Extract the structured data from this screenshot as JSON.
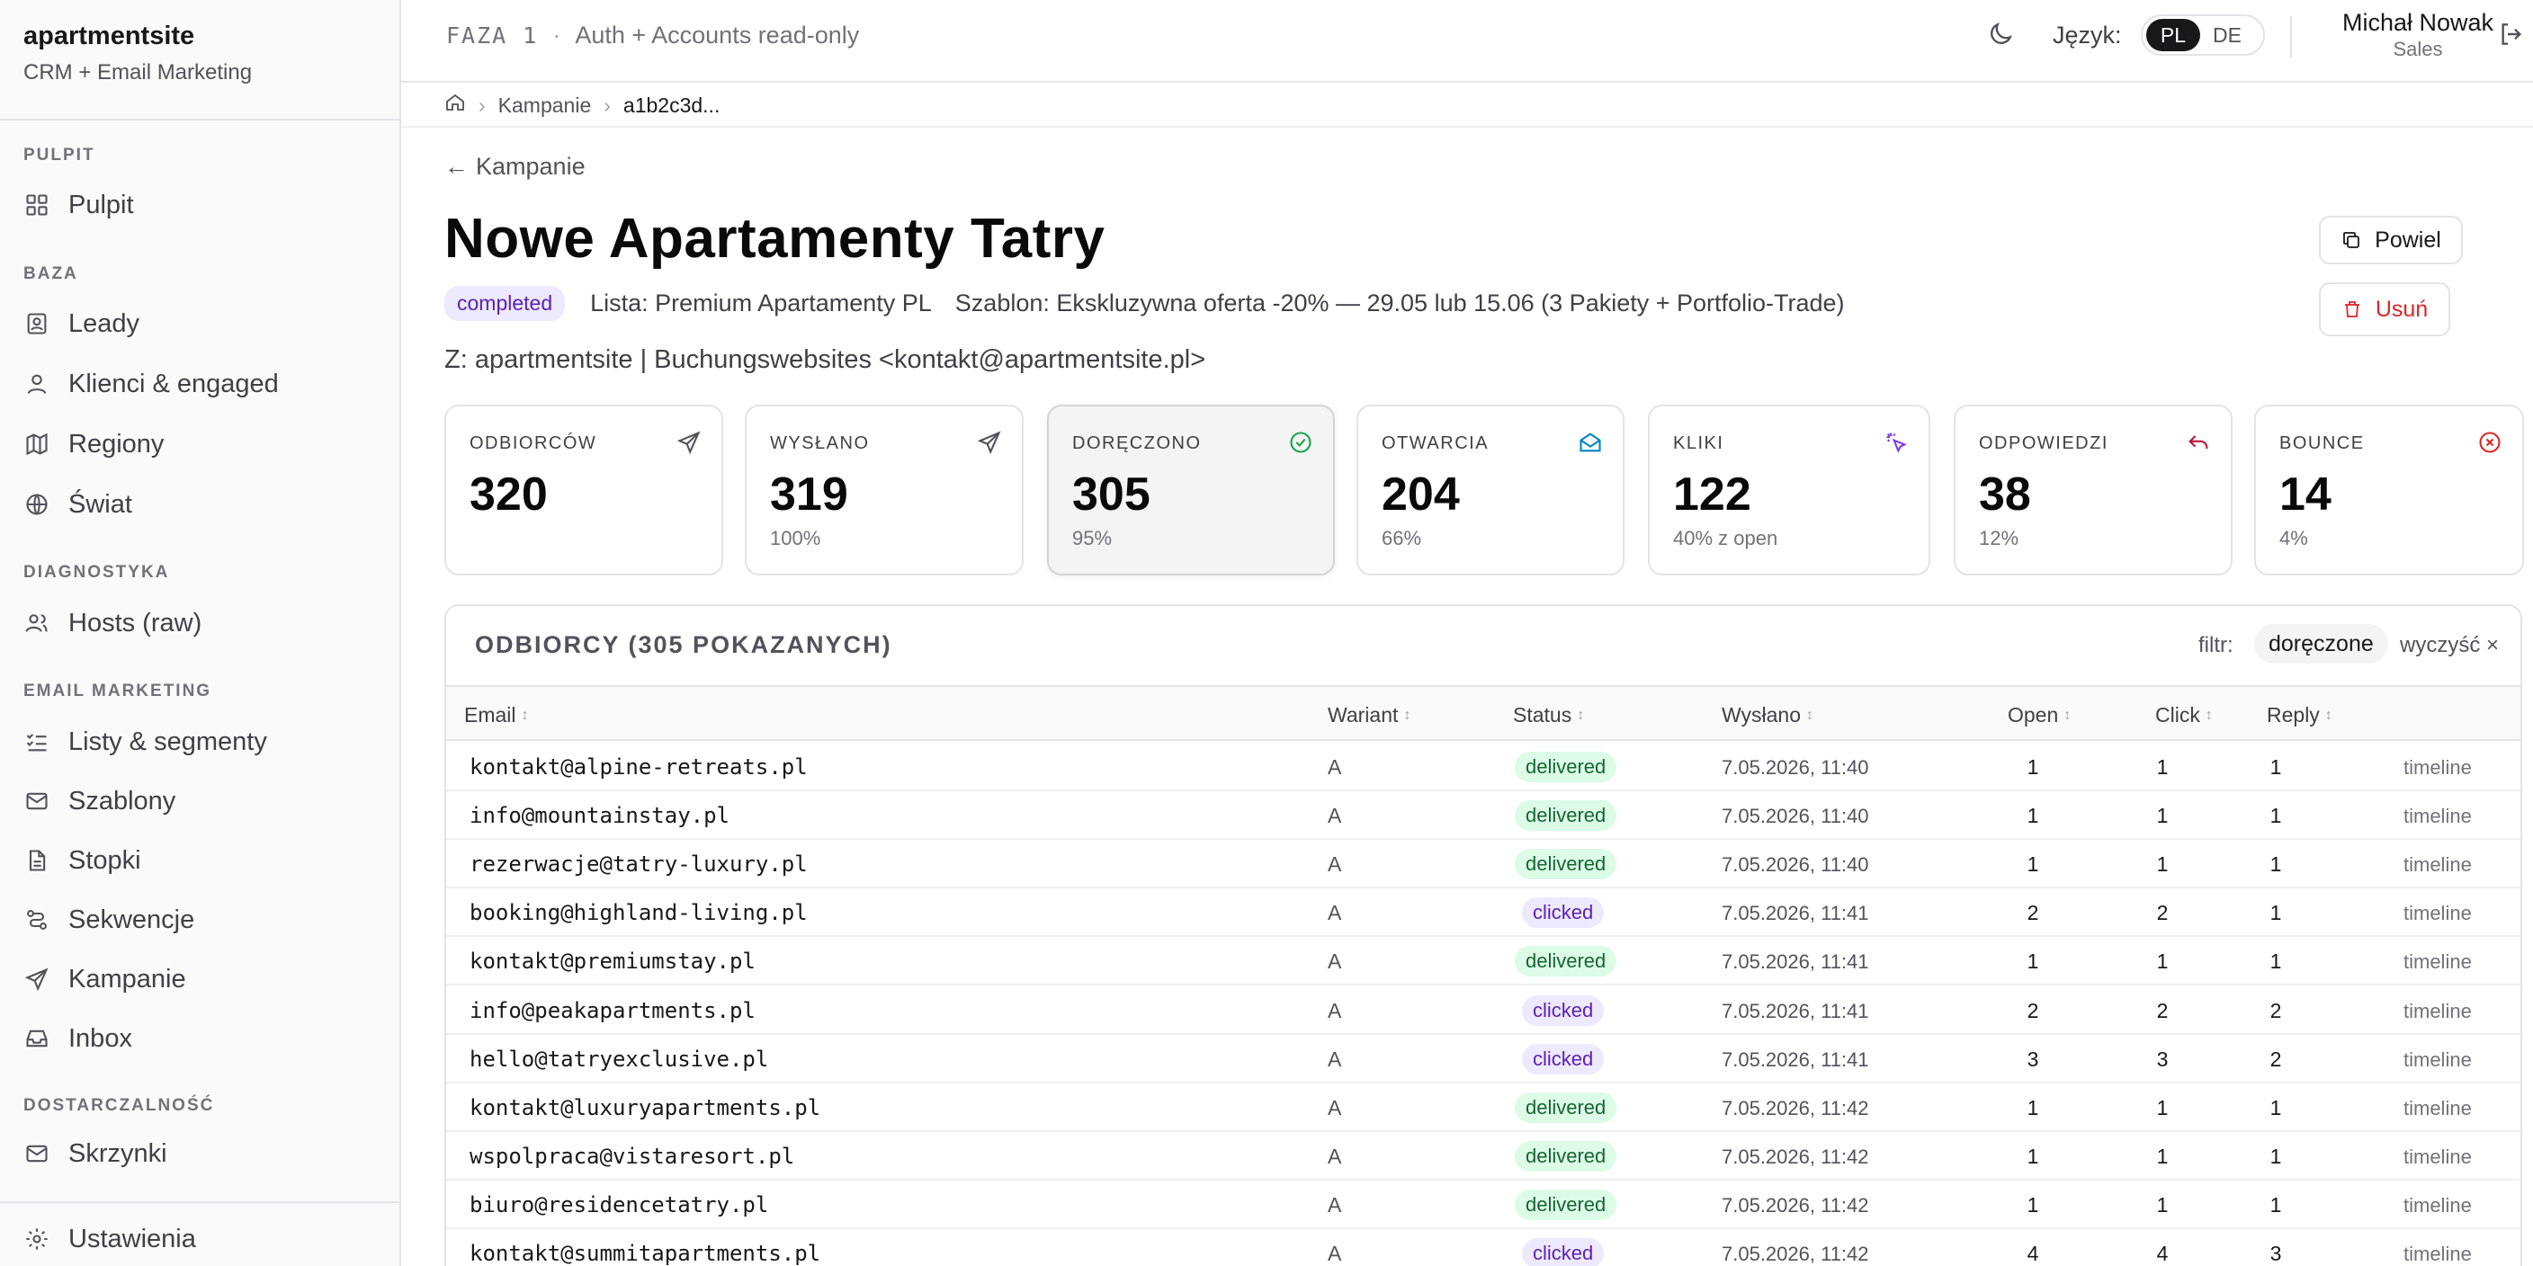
{
  "sidebar": {
    "brand": "apartmentsite",
    "brand_sub": "CRM + Email Marketing",
    "sections": {
      "pulpit": "PULPIT",
      "baza": "BAZA",
      "diagnostyka": "DIAGNOSTYKA",
      "email_marketing": "EMAIL MARKETING",
      "dostarczalnosc": "DOSTARCZALNOŚĆ"
    },
    "items": {
      "pulpit": "Pulpit",
      "leady": "Leady",
      "klienci": "Klienci & engaged",
      "regiony": "Regiony",
      "swiat": "Świat",
      "hosts": "Hosts (raw)",
      "listy": "Listy & segmenty",
      "szablony": "Szablony",
      "stopki": "Stopki",
      "sekwencje": "Sekwencje",
      "kampanie": "Kampanie",
      "inbox": "Inbox",
      "skrzynki": "Skrzynki",
      "ustawienia": "Ustawienia"
    }
  },
  "header": {
    "phase": "FAZA 1",
    "phase_desc": "Auth + Accounts read-only",
    "lang_label": "Język:",
    "lang_options": [
      "PL",
      "DE"
    ],
    "lang_selected": "PL",
    "user_name": "Michał Nowak",
    "user_role": "Sales"
  },
  "breadcrumb": {
    "items": [
      "Kampanie",
      "a1b2c3d..."
    ]
  },
  "campaign": {
    "back_label": "Kampanie",
    "title": "Nowe Apartamenty Tatry",
    "status": "completed",
    "list": "Lista: Premium Apartamenty PL",
    "template": "Szablon: Ekskluzywna oferta -20% — 29.05 lub 15.06 (3 Pakiety + Portfolio-Trade)",
    "from": "Z: apartmentsite | Buchungswebsites <kontakt@apartmentsite.pl>",
    "duplicate_label": "Powiel",
    "delete_label": "Usuń"
  },
  "stats": [
    {
      "label": "ODBIORCÓW",
      "value": "320",
      "sub": "",
      "icon": "send-icon"
    },
    {
      "label": "WYSŁANO",
      "value": "319",
      "sub": "100%",
      "icon": "send-icon"
    },
    {
      "label": "DORĘCZONO",
      "value": "305",
      "sub": "95%",
      "icon": "check-circle-icon"
    },
    {
      "label": "OTWARCIA",
      "value": "204",
      "sub": "66%",
      "icon": "mail-open-icon"
    },
    {
      "label": "KLIKI",
      "value": "122",
      "sub": "40% z open",
      "icon": "pointer-click-icon"
    },
    {
      "label": "ODPOWIEDZI",
      "value": "38",
      "sub": "12%",
      "icon": "reply-icon"
    },
    {
      "label": "BOUNCE",
      "value": "14",
      "sub": "4%",
      "icon": "x-circle-icon"
    }
  ],
  "colors": {
    "delivered_bg": "#dcfce7",
    "clicked_bg": "#ede9fe",
    "danger": "#dc2626",
    "check": "#16a34a",
    "open": "#0284c7",
    "click": "#7c3aed",
    "reply": "#be123c"
  },
  "table": {
    "title": "ODBIORCY (305 POKAZANYCH)",
    "filter_label": "filtr:",
    "filter_value": "doręczone",
    "clear_label": "wyczyść ×",
    "columns": [
      "Email",
      "Wariant",
      "Status",
      "Wysłano",
      "Open",
      "Click",
      "Reply"
    ],
    "rows": [
      {
        "email": "kontakt@alpine-retreats.pl",
        "variant": "A",
        "status": "delivered",
        "sent": "7.05.2026, 11:40",
        "open": "1",
        "click": "1",
        "reply": "1",
        "action": "timeline"
      },
      {
        "email": "info@mountainstay.pl",
        "variant": "A",
        "status": "delivered",
        "sent": "7.05.2026, 11:40",
        "open": "1",
        "click": "1",
        "reply": "1",
        "action": "timeline"
      },
      {
        "email": "rezerwacje@tatry-luxury.pl",
        "variant": "A",
        "status": "delivered",
        "sent": "7.05.2026, 11:40",
        "open": "1",
        "click": "1",
        "reply": "1",
        "action": "timeline"
      },
      {
        "email": "booking@highland-living.pl",
        "variant": "A",
        "status": "clicked",
        "sent": "7.05.2026, 11:41",
        "open": "2",
        "click": "2",
        "reply": "1",
        "action": "timeline"
      },
      {
        "email": "kontakt@premiumstay.pl",
        "variant": "A",
        "status": "delivered",
        "sent": "7.05.2026, 11:41",
        "open": "1",
        "click": "1",
        "reply": "1",
        "action": "timeline"
      },
      {
        "email": "info@peakapartments.pl",
        "variant": "A",
        "status": "clicked",
        "sent": "7.05.2026, 11:41",
        "open": "2",
        "click": "2",
        "reply": "2",
        "action": "timeline"
      },
      {
        "email": "hello@tatryexclusive.pl",
        "variant": "A",
        "status": "clicked",
        "sent": "7.05.2026, 11:41",
        "open": "3",
        "click": "3",
        "reply": "2",
        "action": "timeline"
      },
      {
        "email": "kontakt@luxuryapartments.pl",
        "variant": "A",
        "status": "delivered",
        "sent": "7.05.2026, 11:42",
        "open": "1",
        "click": "1",
        "reply": "1",
        "action": "timeline"
      },
      {
        "email": "wspolpraca@vistaresort.pl",
        "variant": "A",
        "status": "delivered",
        "sent": "7.05.2026, 11:42",
        "open": "1",
        "click": "1",
        "reply": "1",
        "action": "timeline"
      },
      {
        "email": "biuro@residencetatry.pl",
        "variant": "A",
        "status": "delivered",
        "sent": "7.05.2026, 11:42",
        "open": "1",
        "click": "1",
        "reply": "1",
        "action": "timeline"
      },
      {
        "email": "kontakt@summitapartments.pl",
        "variant": "A",
        "status": "clicked",
        "sent": "7.05.2026, 11:42",
        "open": "4",
        "click": "4",
        "reply": "3",
        "action": "timeline"
      }
    ]
  }
}
